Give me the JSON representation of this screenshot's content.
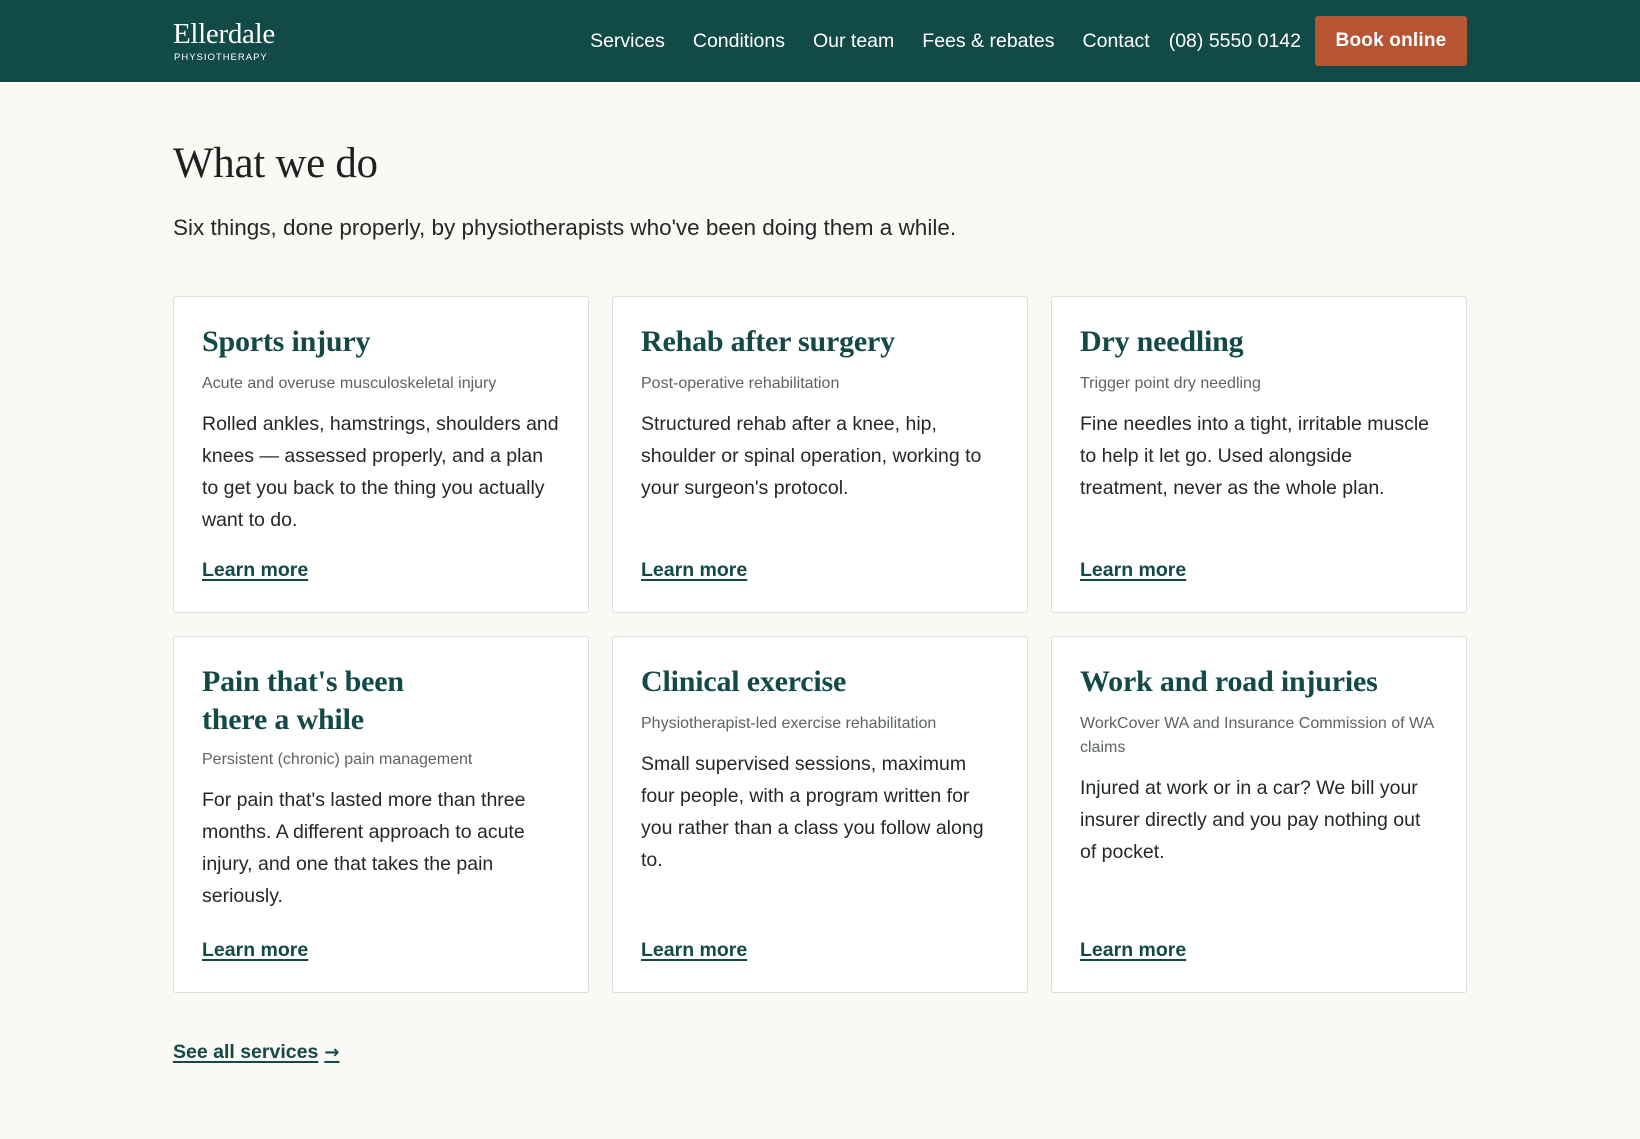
{
  "brand": {
    "name": "Ellerdale",
    "tagline": "PHYSIOTHERAPY"
  },
  "nav": {
    "items": [
      "Services",
      "Conditions",
      "Our team",
      "Fees & rebates",
      "Contact"
    ],
    "phone": "(08) 5550 0142",
    "book_label": "Book online"
  },
  "section": {
    "title": "What we do",
    "intro": "Six things, done properly, by physiotherapists who've been doing them a while."
  },
  "services": [
    {
      "title": "Sports injury",
      "subtitle": "Acute and overuse musculoskeletal injury",
      "body": "Rolled ankles, hamstrings, shoulders and knees — assessed properly, and a plan to get you back to the thing you actually want to do.",
      "link": "Learn more"
    },
    {
      "title": "Rehab after surgery",
      "subtitle": "Post-operative rehabilitation",
      "body": "Structured rehab after a knee, hip, shoulder or spinal operation, working to your surgeon's protocol.",
      "link": "Learn more"
    },
    {
      "title": "Dry needling",
      "subtitle": "Trigger point dry needling",
      "body": "Fine needles into a tight, irritable muscle to help it let go. Used alongside treatment, never as the whole plan.",
      "link": "Learn more"
    },
    {
      "title": "Pain that's been there a while",
      "subtitle": "Persistent (chronic) pain management",
      "body": "For pain that's lasted more than three months. A different approach to acute injury, and one that takes the pain seriously.",
      "link": "Learn more"
    },
    {
      "title": "Clinical exercise",
      "subtitle": "Physiotherapist-led exercise rehabilitation",
      "body": "Small supervised sessions, maximum four people, with a program written for you rather than a class you follow along to.",
      "link": "Learn more"
    },
    {
      "title": "Work and road injuries",
      "subtitle": "WorkCover WA and Insurance Commission of WA claims",
      "body": "Injured at work or in a car? We bill your insurer directly and you pay nothing out of pocket.",
      "link": "Learn more"
    }
  ],
  "footer_link": {
    "label": "See all services",
    "arrow": "→"
  },
  "colors": {
    "header_bg": "#124a48",
    "accent": "#b65434",
    "heading": "#134a47",
    "page_bg": "#faf9f6"
  }
}
